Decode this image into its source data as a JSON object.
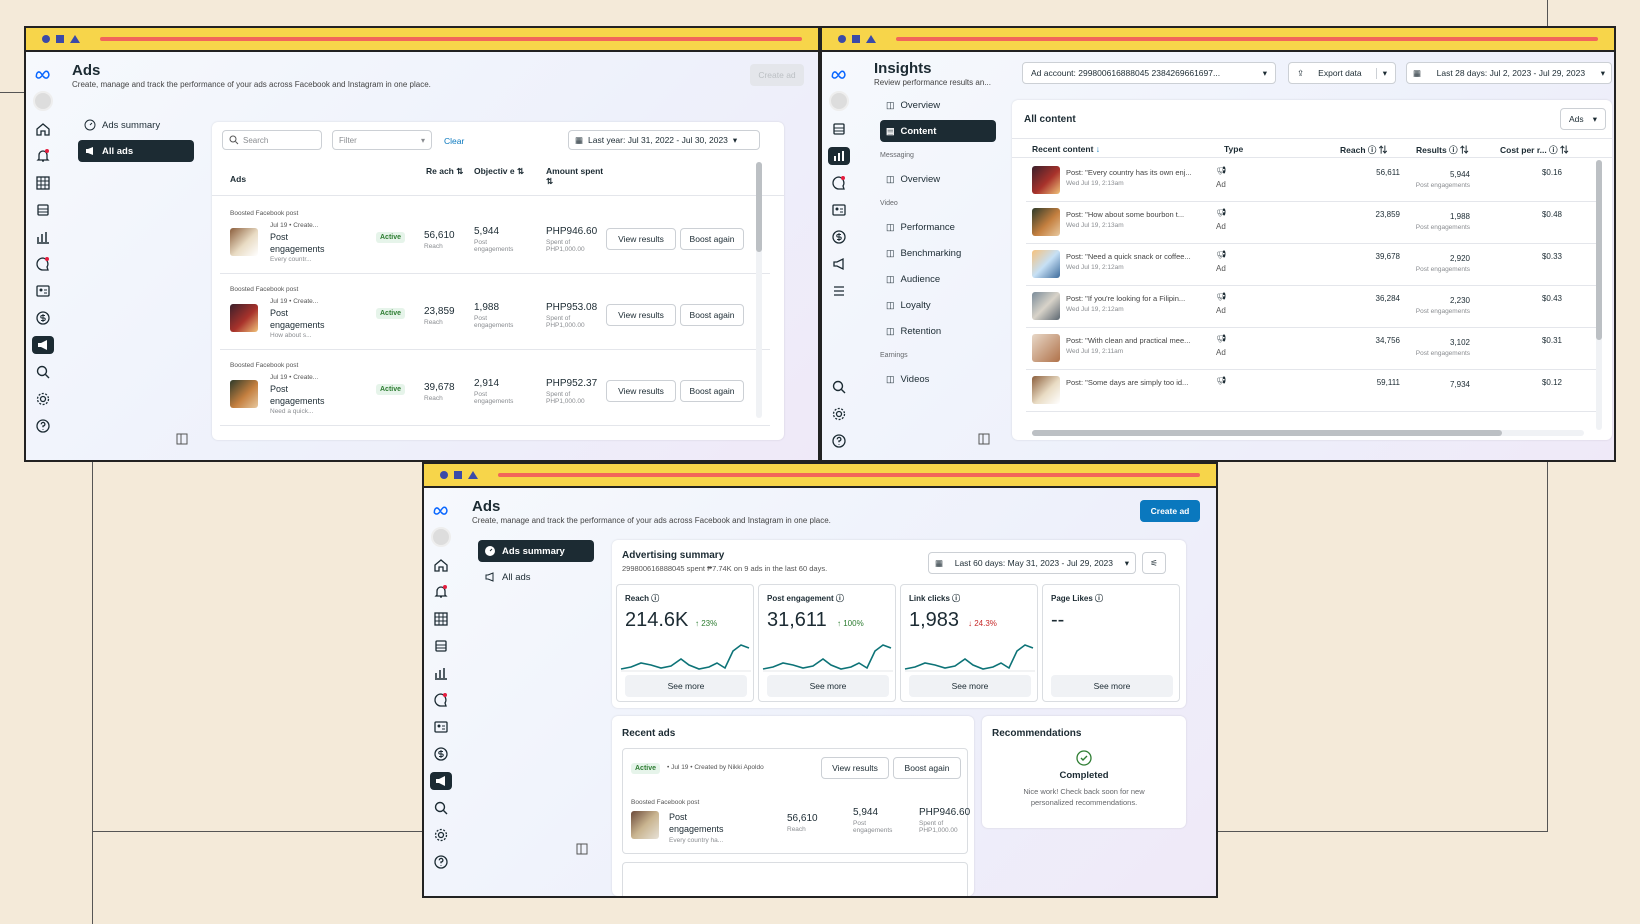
{
  "w1": {
    "title": "Ads",
    "subtitle": "Create, manage and track the performance of your ads across Facebook and Instagram in one place.",
    "create_btn": "Create ad",
    "nav": [
      {
        "label": "Ads summary"
      },
      {
        "label": "All ads"
      }
    ],
    "search_placeholder": "Search",
    "filter_placeholder": "Filter",
    "clear": "Clear",
    "date": "Last year: Jul 31, 2022 - Jul 30, 2023",
    "headers": [
      "Ads",
      "Re ach",
      "Objectiv e",
      "Amount spent"
    ],
    "rows": [
      {
        "tag": "Boosted Facebook post",
        "meta": "Jul 19 • Create...",
        "name": "Post engagements",
        "desc": "Every countr...",
        "status": "Active",
        "reach": "56,610",
        "reach_l": "Reach",
        "obj": "5,944",
        "obj_l": "Post engagements",
        "amount": "PHP946.60",
        "spent": "Spent of PHP1,000.00",
        "view": "View results",
        "boost": "Boost again"
      },
      {
        "tag": "Boosted Facebook post",
        "meta": "Jul 19 • Create...",
        "name": "Post engagements",
        "desc": "How about s...",
        "status": "Active",
        "reach": "23,859",
        "reach_l": "Reach",
        "obj": "1,988",
        "obj_l": "Post engagements",
        "amount": "PHP953.08",
        "spent": "Spent of PHP1,000.00",
        "view": "View results",
        "boost": "Boost again"
      },
      {
        "tag": "Boosted Facebook post",
        "meta": "Jul 19 • Create...",
        "name": "Post engagements",
        "desc": "Need a quick...",
        "status": "Active",
        "reach": "39,678",
        "reach_l": "Reach",
        "obj": "2,914",
        "obj_l": "Post engagements",
        "amount": "PHP952.37",
        "spent": "Spent of PHP1,000.00",
        "view": "View results",
        "boost": "Boost again"
      }
    ]
  },
  "w2": {
    "title": "Insights",
    "subtitle": "Review performance results an...",
    "account": "Ad account: 299800616888045 2384269661697...",
    "export": "Export data",
    "date": "Last 28 days: Jul 2, 2023 - Jul 29, 2023",
    "nav": [
      {
        "label": "Overview"
      },
      {
        "label": "Content"
      },
      {
        "section": "Messaging"
      },
      {
        "label": "Overview"
      },
      {
        "section": "Video"
      },
      {
        "label": "Performance"
      },
      {
        "label": "Benchmarking"
      },
      {
        "label": "Audience"
      },
      {
        "label": "Loyalty"
      },
      {
        "label": "Retention"
      },
      {
        "section": "Earnings"
      },
      {
        "label": "Videos"
      }
    ],
    "table_title": "All content",
    "ads_dd": "Ads",
    "headers": [
      "Recent content",
      "Type",
      "Reach",
      "Results",
      "Cost per r..."
    ],
    "rows": [
      {
        "post": "Post: \"Every country has its own enj...",
        "date": "Wed Jul 19, 2:13am",
        "type": "Ad",
        "reach": "56,611",
        "result": "5,944",
        "result_l": "Post engagements",
        "cost": "$0.16"
      },
      {
        "post": "Post: \"How about some bourbon t...",
        "date": "Wed Jul 19, 2:13am",
        "type": "Ad",
        "reach": "23,859",
        "result": "1,988",
        "result_l": "Post engagements",
        "cost": "$0.48"
      },
      {
        "post": "Post: \"Need a quick snack or coffee...",
        "date": "Wed Jul 19, 2:12am",
        "type": "Ad",
        "reach": "39,678",
        "result": "2,920",
        "result_l": "Post engagements",
        "cost": "$0.33"
      },
      {
        "post": "Post: \"If you're looking for a Filipin...",
        "date": "Wed Jul 19, 2:12am",
        "type": "Ad",
        "reach": "36,284",
        "result": "2,230",
        "result_l": "Post engagements",
        "cost": "$0.43"
      },
      {
        "post": "Post: \"With clean and practical mee...",
        "date": "Wed Jul 19, 2:11am",
        "type": "Ad",
        "reach": "34,756",
        "result": "3,102",
        "result_l": "Post engagements",
        "cost": "$0.31"
      },
      {
        "post": "Post: \"Some days are simply too id...",
        "date": "",
        "type": "",
        "reach": "59,111",
        "result": "7,934",
        "result_l": "",
        "cost": "$0.12"
      }
    ]
  },
  "w3": {
    "title": "Ads",
    "subtitle": "Create, manage and track the performance of your ads across Facebook and Instagram in one place.",
    "create_btn": "Create ad",
    "nav": [
      {
        "label": "Ads summary"
      },
      {
        "label": "All ads"
      }
    ],
    "summary_title": "Advertising summary",
    "summary_sub": "299800616888045 spent ₱7.74K on 9 ads in the last 60 days.",
    "date": "Last 60 days: May 31, 2023 - Jul 29, 2023",
    "metrics": [
      {
        "label": "Reach",
        "value": "214.6K",
        "delta": "↑ 23%",
        "dir": "up",
        "see": "See more"
      },
      {
        "label": "Post engagement",
        "value": "31,611",
        "delta": "↑ 100%",
        "dir": "up",
        "see": "See more"
      },
      {
        "label": "Link clicks",
        "value": "1,983",
        "delta": "↓ 24.3%",
        "dir": "down",
        "see": "See more"
      },
      {
        "label": "Page Likes",
        "value": "--",
        "delta": "",
        "dir": "",
        "see": "See more"
      }
    ],
    "recent_title": "Recent ads",
    "recent": {
      "status": "Active",
      "meta": "• Jul 19 • Created by Nikki Apoldo",
      "view": "View results",
      "boost": "Boost again",
      "tag": "Boosted Facebook post",
      "name": "Post engagements",
      "desc": "Every country ha...",
      "reach": "56,610",
      "reach_l": "Reach",
      "obj": "5,944",
      "obj_l": "Post engagements",
      "amount": "PHP946.60",
      "spent": "Spent of PHP1,000.00"
    },
    "rec_title": "Recommendations",
    "rec_status": "Completed",
    "rec_text": "Nice work! Check back soon for new personalized recommendations."
  },
  "colors": {
    "accent": "#0a78be",
    "active_nav": "#1c2b33",
    "up": "#2e7d32",
    "down": "#c62828",
    "chart": "#0d7377"
  }
}
